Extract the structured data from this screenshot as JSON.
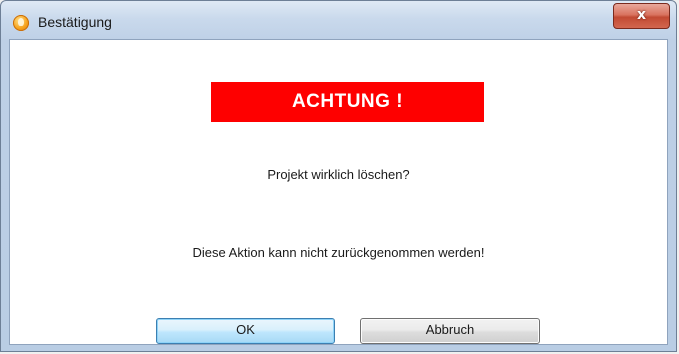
{
  "window": {
    "title": "Bestätigung",
    "close_label": "x"
  },
  "dialog": {
    "banner_text": "ACHTUNG !",
    "question": "Projekt wirklich löschen?",
    "warning": "Diese Aktion kann nicht zurückgenommen werden!"
  },
  "buttons": {
    "ok_label": "OK",
    "cancel_label": "Abbruch"
  },
  "colors": {
    "banner_background": "#fe0000",
    "banner_text": "#ffffff"
  },
  "icons": {
    "title_icon": "app-icon"
  }
}
